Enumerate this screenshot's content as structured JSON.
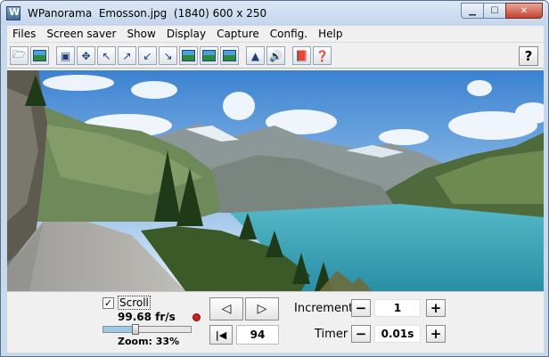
{
  "window": {
    "title": "WPanorama  Emosson.jpg  (1840) 600 x 250",
    "buttons": {
      "minimize": "▁",
      "maximize": "☐",
      "close": "✕"
    }
  },
  "menu": [
    "Files",
    "Screen saver",
    "Show",
    "Display",
    "Capture",
    "Config.",
    "Help"
  ],
  "toolbar": {
    "icons": [
      "open-icon",
      "picture-icon",
      "fit-icon",
      "center-icon",
      "move-up-left-icon",
      "move-right-up-icon",
      "move-left-down-icon",
      "move-down-right-icon",
      "scene-1-icon",
      "scene-2-icon",
      "scene-3-icon",
      "tree-icon",
      "sound-icon",
      "book-icon",
      "help-page-icon"
    ],
    "help_label": "?"
  },
  "controls": {
    "scroll_checked": "✓",
    "scroll_label": "Scroll",
    "speed": "99.68 fr/s",
    "zoom_label": "Zoom: 33%",
    "zoom_value": 0.33,
    "prev_label": "◁",
    "next_label": "▷",
    "first_label": "|◀",
    "position": "94",
    "increment_label": "Increment",
    "increment_value": "1",
    "timer_label": "Timer",
    "timer_value": "0.01s",
    "minus": "−",
    "plus": "+"
  },
  "colors": {
    "sky": "#3e85d3",
    "lake": "#3aa5b8",
    "mountain": "#6f7a78",
    "forest": "#2f4a25",
    "slider_fill": "#9ccbea"
  }
}
